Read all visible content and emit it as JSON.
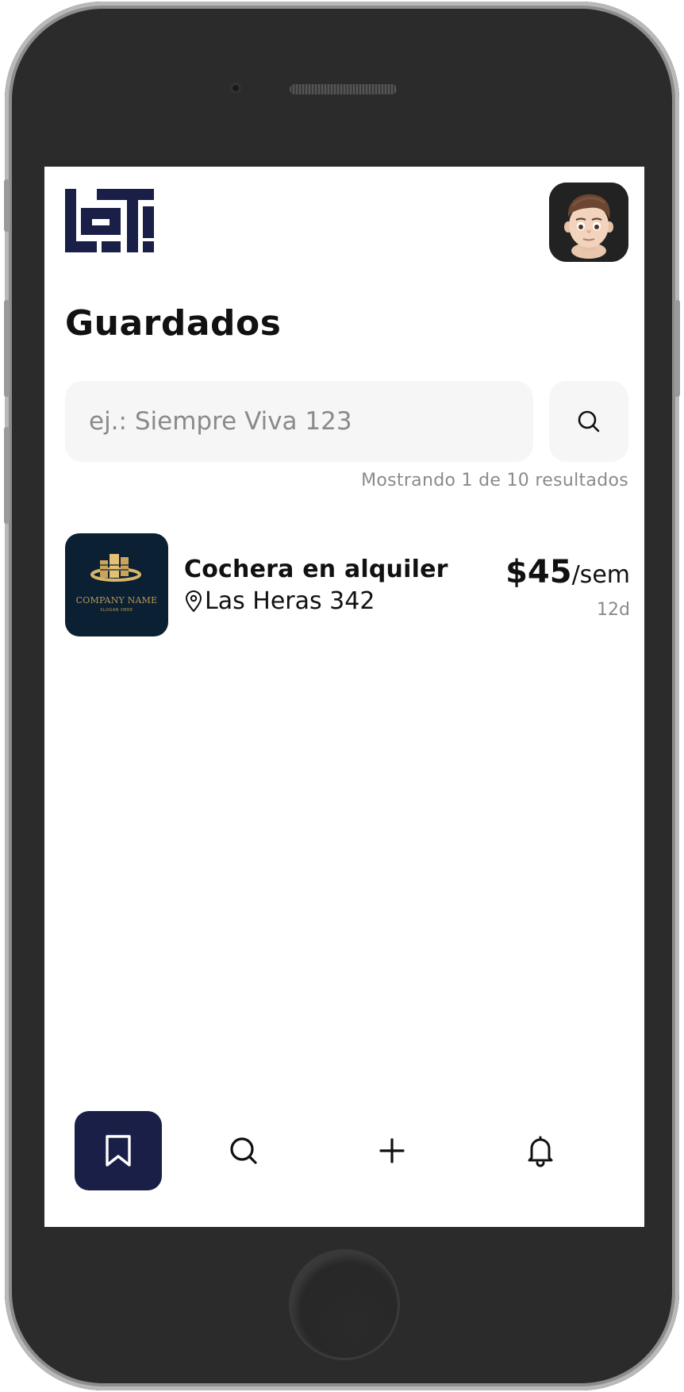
{
  "app": {
    "logo_text": "LOTI",
    "brand_color": "#1a1f47"
  },
  "header": {
    "title": "Guardados",
    "avatar_icon": "memoji-avatar"
  },
  "search": {
    "placeholder": "ej.: Siempre Viva 123",
    "value": "",
    "button_icon": "search-icon"
  },
  "results": {
    "summary": "Mostrando 1 de 10 resultados"
  },
  "listings": [
    {
      "thumbnail_company": "COMPANY NAME",
      "thumbnail_slogan": "SLOGAN HERE",
      "title": "Cochera en alquiler",
      "address_icon": "location-pin-icon",
      "address": "Las Heras 342",
      "price": "$45",
      "period": "/sem",
      "age": "12d"
    }
  ],
  "bottom_nav": {
    "items": [
      {
        "icon": "bookmark-icon",
        "active": true
      },
      {
        "icon": "search-icon",
        "active": false
      },
      {
        "icon": "plus-icon",
        "active": false
      },
      {
        "icon": "bell-icon",
        "active": false
      }
    ]
  }
}
